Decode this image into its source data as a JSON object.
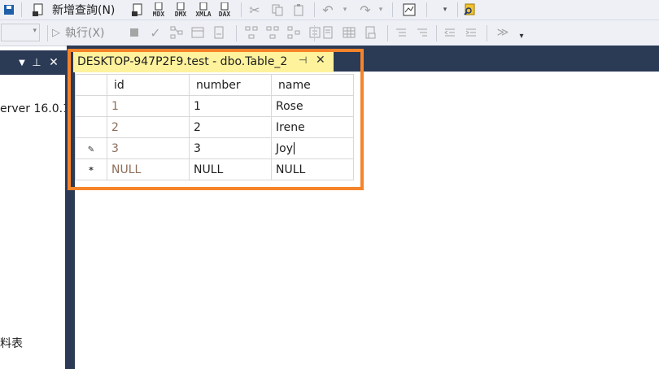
{
  "toolbar_top": {
    "new_query_label": "新增查詢(N)",
    "mdx_label": "MDX",
    "dmx_label": "DMX",
    "xmla_label": "XMLA",
    "dax_label": "DAX"
  },
  "toolbar_second": {
    "execute_label": "執行(X)"
  },
  "object_explorer": {
    "server_text": "erver 16.0.1",
    "tables_text": "料表"
  },
  "document_tab": {
    "title": "DESKTOP-947P2F9.test - dbo.Table_2",
    "accent": "#fff29d"
  },
  "grid": {
    "columns": [
      "id",
      "number",
      "name"
    ],
    "rows": [
      {
        "marker": "",
        "id": "1",
        "number": "1",
        "name": "Rose"
      },
      {
        "marker": "edit-pencil",
        "id": "2",
        "number": "2",
        "name": "Irene"
      },
      {
        "marker": "editing",
        "id": "3",
        "number": "3",
        "name": "Joy"
      },
      {
        "marker": "new-row",
        "id": "NULL",
        "number": "NULL",
        "name": "NULL"
      }
    ]
  },
  "colors": {
    "header_dark": "#2b3a55",
    "highlight": "#f6842a"
  }
}
